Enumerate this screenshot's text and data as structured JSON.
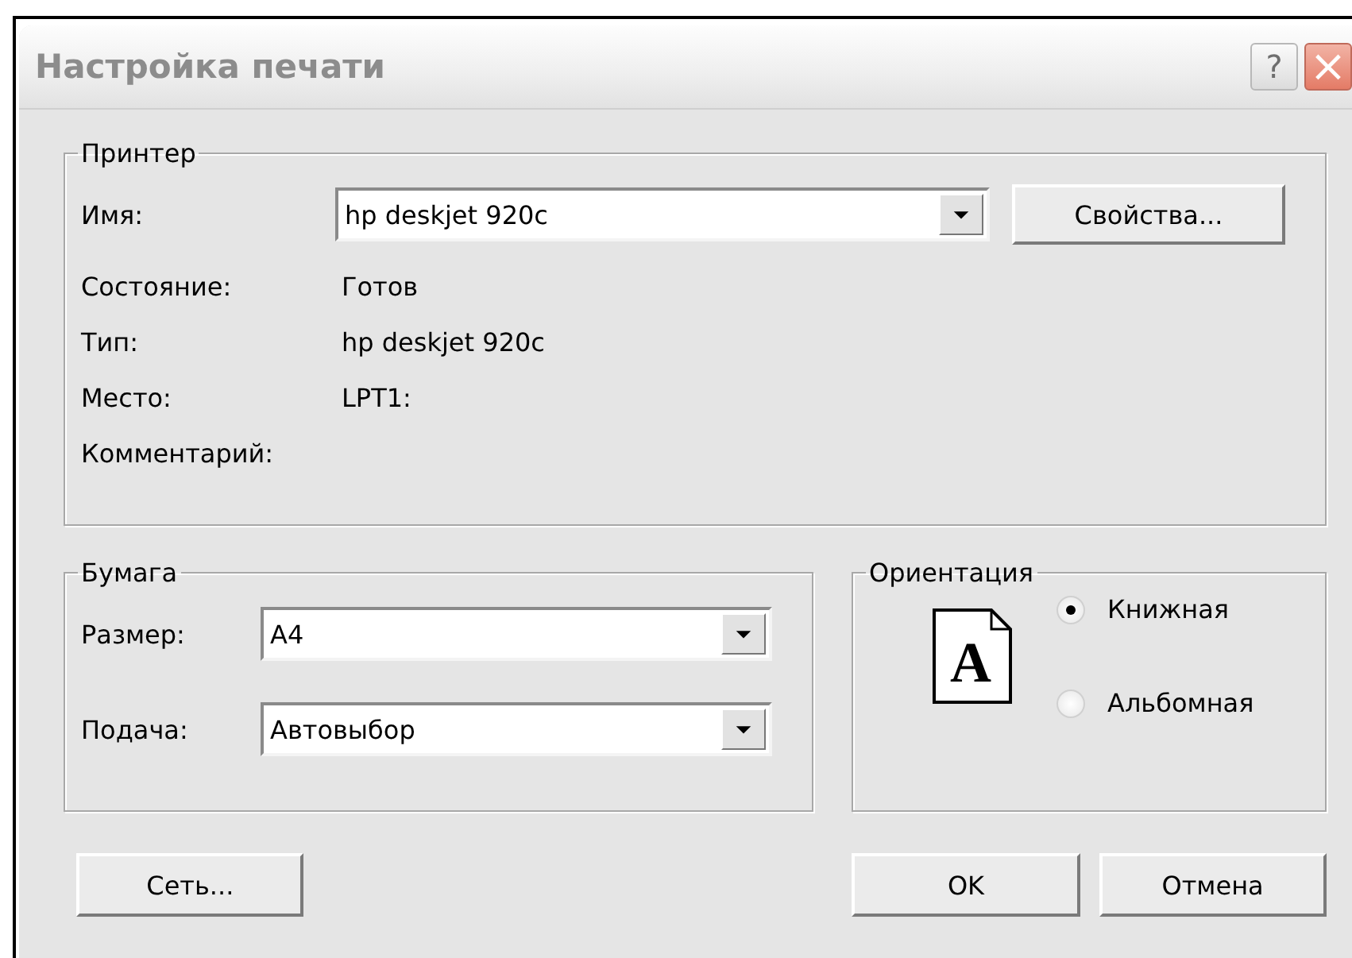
{
  "window": {
    "title": "Настройка печати",
    "help_button": "?",
    "close_button": "×"
  },
  "printer": {
    "legend": "Принтер",
    "name_label": "Имя:",
    "name_value": "hp deskjet 920c",
    "properties_button": "Свойства...",
    "info": [
      {
        "label": "Состояние:",
        "value": "Готов"
      },
      {
        "label": "Тип:",
        "value": "hp deskjet 920c"
      },
      {
        "label": "Место:",
        "value": "LPT1:"
      },
      {
        "label": "Комментарий:"
      }
    ]
  },
  "paper": {
    "legend": "Бумага",
    "fields": [
      {
        "label": "Размер:",
        "value": "A4"
      },
      {
        "label": "Подача:",
        "value": "Автовыбор"
      }
    ]
  },
  "orientation": {
    "legend": "Ориентация",
    "page_icon_letter": "A",
    "options": [
      {
        "label": "Книжная",
        "selected": true
      },
      {
        "label": "Альбомная",
        "selected": false
      }
    ]
  },
  "buttons": {
    "network": "Сеть...",
    "ok": "OK",
    "cancel": "Отмена"
  }
}
